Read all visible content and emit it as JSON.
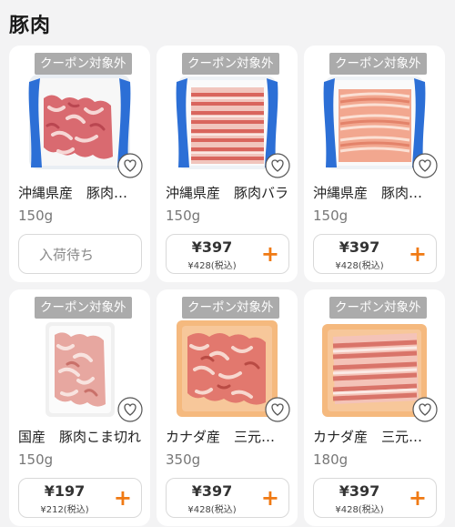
{
  "section": {
    "title": "豚肉"
  },
  "colors": {
    "accent": "#f07a14",
    "background": "#f3f3f4"
  },
  "products": [
    {
      "coupon": "クーポン対象外",
      "name": "沖縄県産　豚肉こま切れ",
      "weight": "150g",
      "status": "入荷待ち",
      "price": "",
      "price_tax": "",
      "image": "pork-pieces-tray-icon"
    },
    {
      "coupon": "クーポン対象外",
      "name": "沖縄県産　豚肉バラ",
      "weight": "150g",
      "status": "",
      "price": "¥397",
      "price_tax": "¥428(税込)",
      "image": "pork-belly-slices-tray-icon"
    },
    {
      "coupon": "クーポン対象外",
      "name": "沖縄県産　豚肉ロース",
      "weight": "150g",
      "status": "",
      "price": "¥397",
      "price_tax": "¥428(税込)",
      "image": "pork-loin-slices-tray-icon"
    },
    {
      "coupon": "クーポン対象外",
      "name": "国産　豚肉こま切れ",
      "weight": "150g",
      "status": "",
      "price": "¥197",
      "price_tax": "¥212(税込)",
      "image": "pork-pieces-white-tray-icon"
    },
    {
      "coupon": "クーポン対象外",
      "name": "カナダ産　三元豚こま切れ",
      "weight": "350g",
      "status": "",
      "price": "¥397",
      "price_tax": "¥428(税込)",
      "image": "pork-pieces-orange-tray-icon"
    },
    {
      "coupon": "クーポン対象外",
      "name": "カナダ産　三元豚バラ",
      "weight": "180g",
      "status": "",
      "price": "¥397",
      "price_tax": "¥428(税込)",
      "image": "pork-belly-orange-tray-icon"
    }
  ]
}
